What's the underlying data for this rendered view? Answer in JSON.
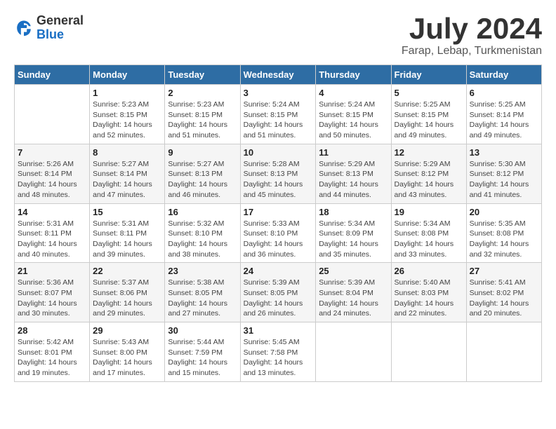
{
  "logo": {
    "line1": "General",
    "line2": "Blue"
  },
  "title": "July 2024",
  "subtitle": "Farap, Lebap, Turkmenistan",
  "header": {
    "accent_color": "#2e6da4"
  },
  "days_of_week": [
    "Sunday",
    "Monday",
    "Tuesday",
    "Wednesday",
    "Thursday",
    "Friday",
    "Saturday"
  ],
  "weeks": [
    [
      {
        "day": "",
        "sunrise": "",
        "sunset": "",
        "daylight": ""
      },
      {
        "day": "1",
        "sunrise": "Sunrise: 5:23 AM",
        "sunset": "Sunset: 8:15 PM",
        "daylight": "Daylight: 14 hours and 52 minutes."
      },
      {
        "day": "2",
        "sunrise": "Sunrise: 5:23 AM",
        "sunset": "Sunset: 8:15 PM",
        "daylight": "Daylight: 14 hours and 51 minutes."
      },
      {
        "day": "3",
        "sunrise": "Sunrise: 5:24 AM",
        "sunset": "Sunset: 8:15 PM",
        "daylight": "Daylight: 14 hours and 51 minutes."
      },
      {
        "day": "4",
        "sunrise": "Sunrise: 5:24 AM",
        "sunset": "Sunset: 8:15 PM",
        "daylight": "Daylight: 14 hours and 50 minutes."
      },
      {
        "day": "5",
        "sunrise": "Sunrise: 5:25 AM",
        "sunset": "Sunset: 8:15 PM",
        "daylight": "Daylight: 14 hours and 49 minutes."
      },
      {
        "day": "6",
        "sunrise": "Sunrise: 5:25 AM",
        "sunset": "Sunset: 8:14 PM",
        "daylight": "Daylight: 14 hours and 49 minutes."
      }
    ],
    [
      {
        "day": "7",
        "sunrise": "Sunrise: 5:26 AM",
        "sunset": "Sunset: 8:14 PM",
        "daylight": "Daylight: 14 hours and 48 minutes."
      },
      {
        "day": "8",
        "sunrise": "Sunrise: 5:27 AM",
        "sunset": "Sunset: 8:14 PM",
        "daylight": "Daylight: 14 hours and 47 minutes."
      },
      {
        "day": "9",
        "sunrise": "Sunrise: 5:27 AM",
        "sunset": "Sunset: 8:13 PM",
        "daylight": "Daylight: 14 hours and 46 minutes."
      },
      {
        "day": "10",
        "sunrise": "Sunrise: 5:28 AM",
        "sunset": "Sunset: 8:13 PM",
        "daylight": "Daylight: 14 hours and 45 minutes."
      },
      {
        "day": "11",
        "sunrise": "Sunrise: 5:29 AM",
        "sunset": "Sunset: 8:13 PM",
        "daylight": "Daylight: 14 hours and 44 minutes."
      },
      {
        "day": "12",
        "sunrise": "Sunrise: 5:29 AM",
        "sunset": "Sunset: 8:12 PM",
        "daylight": "Daylight: 14 hours and 43 minutes."
      },
      {
        "day": "13",
        "sunrise": "Sunrise: 5:30 AM",
        "sunset": "Sunset: 8:12 PM",
        "daylight": "Daylight: 14 hours and 41 minutes."
      }
    ],
    [
      {
        "day": "14",
        "sunrise": "Sunrise: 5:31 AM",
        "sunset": "Sunset: 8:11 PM",
        "daylight": "Daylight: 14 hours and 40 minutes."
      },
      {
        "day": "15",
        "sunrise": "Sunrise: 5:31 AM",
        "sunset": "Sunset: 8:11 PM",
        "daylight": "Daylight: 14 hours and 39 minutes."
      },
      {
        "day": "16",
        "sunrise": "Sunrise: 5:32 AM",
        "sunset": "Sunset: 8:10 PM",
        "daylight": "Daylight: 14 hours and 38 minutes."
      },
      {
        "day": "17",
        "sunrise": "Sunrise: 5:33 AM",
        "sunset": "Sunset: 8:10 PM",
        "daylight": "Daylight: 14 hours and 36 minutes."
      },
      {
        "day": "18",
        "sunrise": "Sunrise: 5:34 AM",
        "sunset": "Sunset: 8:09 PM",
        "daylight": "Daylight: 14 hours and 35 minutes."
      },
      {
        "day": "19",
        "sunrise": "Sunrise: 5:34 AM",
        "sunset": "Sunset: 8:08 PM",
        "daylight": "Daylight: 14 hours and 33 minutes."
      },
      {
        "day": "20",
        "sunrise": "Sunrise: 5:35 AM",
        "sunset": "Sunset: 8:08 PM",
        "daylight": "Daylight: 14 hours and 32 minutes."
      }
    ],
    [
      {
        "day": "21",
        "sunrise": "Sunrise: 5:36 AM",
        "sunset": "Sunset: 8:07 PM",
        "daylight": "Daylight: 14 hours and 30 minutes."
      },
      {
        "day": "22",
        "sunrise": "Sunrise: 5:37 AM",
        "sunset": "Sunset: 8:06 PM",
        "daylight": "Daylight: 14 hours and 29 minutes."
      },
      {
        "day": "23",
        "sunrise": "Sunrise: 5:38 AM",
        "sunset": "Sunset: 8:05 PM",
        "daylight": "Daylight: 14 hours and 27 minutes."
      },
      {
        "day": "24",
        "sunrise": "Sunrise: 5:39 AM",
        "sunset": "Sunset: 8:05 PM",
        "daylight": "Daylight: 14 hours and 26 minutes."
      },
      {
        "day": "25",
        "sunrise": "Sunrise: 5:39 AM",
        "sunset": "Sunset: 8:04 PM",
        "daylight": "Daylight: 14 hours and 24 minutes."
      },
      {
        "day": "26",
        "sunrise": "Sunrise: 5:40 AM",
        "sunset": "Sunset: 8:03 PM",
        "daylight": "Daylight: 14 hours and 22 minutes."
      },
      {
        "day": "27",
        "sunrise": "Sunrise: 5:41 AM",
        "sunset": "Sunset: 8:02 PM",
        "daylight": "Daylight: 14 hours and 20 minutes."
      }
    ],
    [
      {
        "day": "28",
        "sunrise": "Sunrise: 5:42 AM",
        "sunset": "Sunset: 8:01 PM",
        "daylight": "Daylight: 14 hours and 19 minutes."
      },
      {
        "day": "29",
        "sunrise": "Sunrise: 5:43 AM",
        "sunset": "Sunset: 8:00 PM",
        "daylight": "Daylight: 14 hours and 17 minutes."
      },
      {
        "day": "30",
        "sunrise": "Sunrise: 5:44 AM",
        "sunset": "Sunset: 7:59 PM",
        "daylight": "Daylight: 14 hours and 15 minutes."
      },
      {
        "day": "31",
        "sunrise": "Sunrise: 5:45 AM",
        "sunset": "Sunset: 7:58 PM",
        "daylight": "Daylight: 14 hours and 13 minutes."
      },
      {
        "day": "",
        "sunrise": "",
        "sunset": "",
        "daylight": ""
      },
      {
        "day": "",
        "sunrise": "",
        "sunset": "",
        "daylight": ""
      },
      {
        "day": "",
        "sunrise": "",
        "sunset": "",
        "daylight": ""
      }
    ]
  ]
}
